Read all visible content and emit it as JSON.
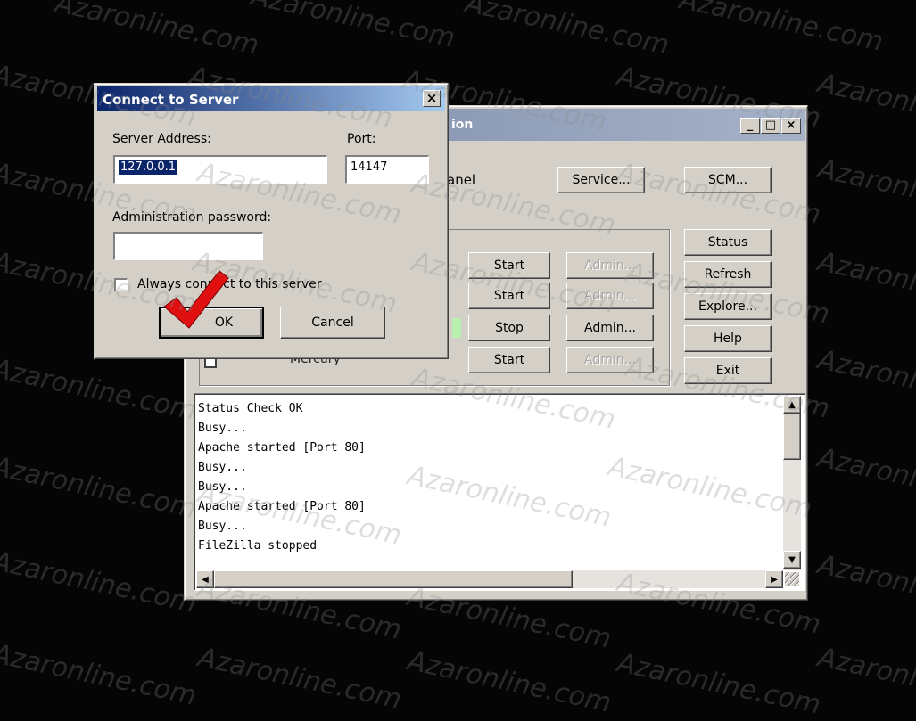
{
  "xampp_window": {
    "title_fragment": "ion",
    "caption_buttons": [
      "_",
      "□",
      "×"
    ],
    "panel_label_fragment": "anel",
    "service_button": "Service...",
    "scm_button": "SCM...",
    "right_buttons": [
      "Status",
      "Refresh",
      "Explore...",
      "Help",
      "Exit"
    ],
    "modules": [
      {
        "name": "",
        "action": "Start",
        "admin": "Admin...",
        "admin_enabled": false
      },
      {
        "name": "",
        "action": "Start",
        "admin": "Admin...",
        "admin_enabled": false
      },
      {
        "name": "",
        "action": "Stop",
        "admin": "Admin...",
        "admin_enabled": true
      },
      {
        "name": "Mercury",
        "action": "Start",
        "admin": "Admin...",
        "admin_enabled": false
      }
    ],
    "log_lines": [
      "Status Check OK",
      "Busy...",
      "Apache started [Port 80]",
      "Busy...",
      "Busy...",
      "Apache started [Port 80]",
      "Busy...",
      "FileZilla stopped"
    ]
  },
  "connect_dialog": {
    "title": "Connect to Server",
    "close_glyph": "×",
    "server_address_label": "Server Address:",
    "server_address_value": "127.0.0.1",
    "port_label": "Port:",
    "port_value": "14147",
    "password_label": "Administration password:",
    "password_value": "",
    "always_connect_label": "Always connect to this server",
    "always_connect_checked": false,
    "ok_button": "OK",
    "cancel_button": "Cancel"
  },
  "watermark": "Azaronline.com",
  "colors": {
    "dialog_title_bar": "#0a246a",
    "checkmark": "#e01010",
    "window_face": "#d4d0c8"
  }
}
